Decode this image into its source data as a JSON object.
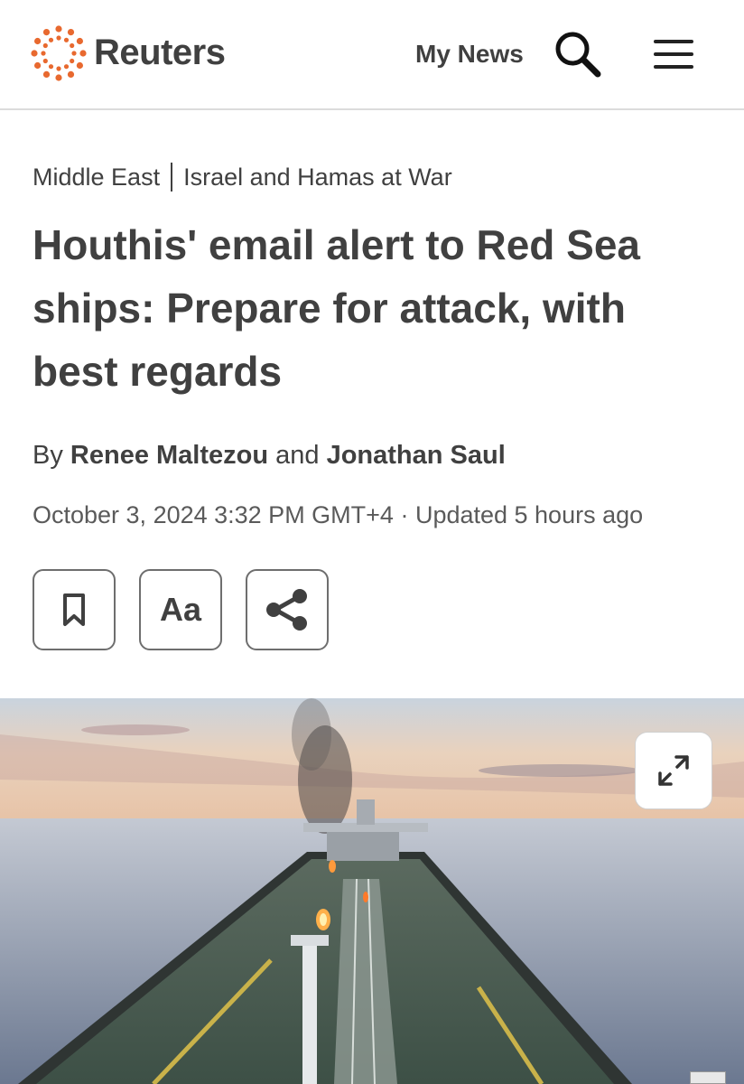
{
  "header": {
    "brand": "Reuters",
    "my_news": "My News"
  },
  "article": {
    "breadcrumb": [
      "Middle East",
      "Israel and Hamas at War"
    ],
    "headline": "Houthis' email alert to Red Sea ships: Prepare for attack, with best regards",
    "byline": {
      "prefix": "By",
      "author1": "Renee Maltezou",
      "joiner": "and",
      "author2": "Jonathan Saul"
    },
    "dateline": "October 3, 2024 3:32 PM GMT+4 · Updated 5 hours ago"
  },
  "tools": {
    "font_label": "Aa"
  },
  "icons": {
    "logo": "reuters-dot-logo",
    "search": "search-icon",
    "menu": "hamburger-menu-icon",
    "bookmark": "bookmark-icon",
    "share": "share-icon",
    "expand": "expand-icon"
  },
  "colors": {
    "brand_orange": "#e8692f",
    "text": "#404040"
  }
}
